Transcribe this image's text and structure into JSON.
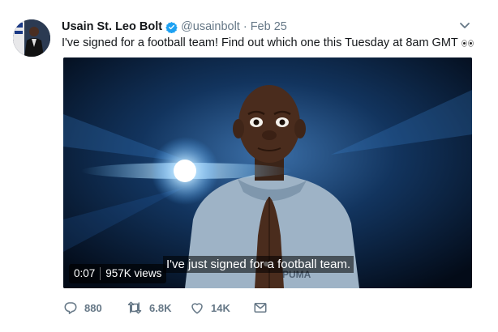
{
  "tweet": {
    "display_name": "Usain St. Leo Bolt",
    "handle": "@usainbolt",
    "separator": "·",
    "date": "Feb 25",
    "text": "I've signed for a football team! Find out which one this Tuesday at 8am GMT",
    "emoji_icon": "eyes-emoji-icon"
  },
  "video": {
    "subtitle": "I've just signed for a football team.",
    "duration": "0:07",
    "views": "957K views"
  },
  "actions": {
    "reply_count": "880",
    "retweet_count": "6.8K",
    "like_count": "14K"
  },
  "colors": {
    "secondary_text": "#657786",
    "verified_badge": "#1da1f2",
    "video_background": "#061528"
  }
}
